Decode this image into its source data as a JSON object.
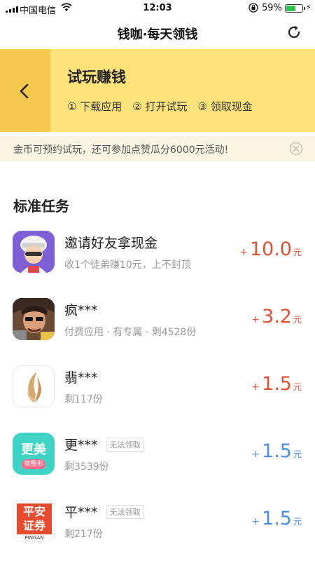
{
  "status_bar": {
    "carrier": "中国电信",
    "time": "12:03",
    "battery_pct": "59%",
    "battery_level": 0.59,
    "icons": [
      "signal-icon",
      "wifi-icon",
      "orientation-lock-icon",
      "battery-icon",
      "charging-icon"
    ]
  },
  "nav": {
    "title": "钱咖·每天领钱",
    "refresh_icon": "refresh-icon"
  },
  "banner": {
    "title": "试玩赚钱",
    "back_icon": "chevron-left-icon",
    "steps": [
      {
        "num": "①",
        "label": "下载应用"
      },
      {
        "num": "②",
        "label": "打开试玩"
      },
      {
        "num": "③",
        "label": "领取现金"
      }
    ]
  },
  "notice": {
    "text": "金币可预约试玩，还可参加点赞瓜分6000元活动!",
    "close_icon": "close-circle-icon"
  },
  "section": {
    "title": "标准任务"
  },
  "tasks": [
    {
      "name": "邀请好友拿现金",
      "sub": "收1个徒弟赚10元，上不封顶",
      "badge": "",
      "plus": "+",
      "amount": "10.0",
      "unit": "元",
      "reward_color": "#e2502f",
      "icon": "invite-friends-app-icon"
    },
    {
      "name": "疯***",
      "sub": "付费应用 · 有专属 · 剩4528份",
      "badge": "",
      "plus": "+",
      "amount": "3.2",
      "unit": "元",
      "reward_color": "#e2502f",
      "icon": "game-app-icon"
    },
    {
      "name": "翡***",
      "sub": "剩117份",
      "badge": "",
      "plus": "+",
      "amount": "1.5",
      "unit": "元",
      "reward_color": "#e2502f",
      "icon": "feather-app-icon"
    },
    {
      "name": "更***",
      "sub": "剩3539份",
      "badge": "无法领取",
      "plus": "+",
      "amount": "1.5",
      "unit": "元",
      "reward_color": "#4a8fe0",
      "icon": "gengmei-app-icon",
      "icon_text_top": "更美",
      "icon_text_bottom": "微整形"
    },
    {
      "name": "平***",
      "sub": "剩217份",
      "badge": "无法领取",
      "plus": "+",
      "amount": "1.5",
      "unit": "元",
      "reward_color": "#4a8fe0",
      "icon": "pingan-app-icon",
      "icon_text_top": "平安",
      "icon_text_mid": "证券",
      "icon_text_bottom": "PINGAN"
    }
  ]
}
